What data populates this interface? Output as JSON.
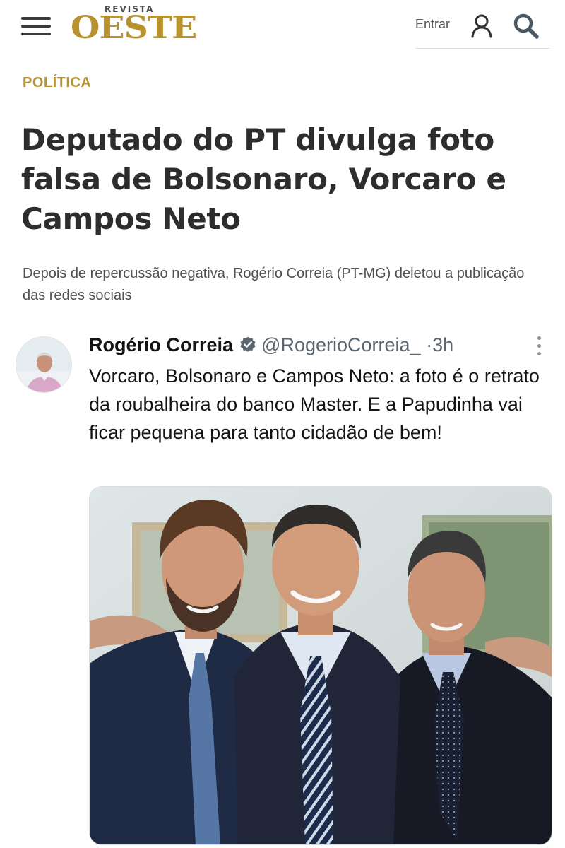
{
  "header": {
    "logo_small": "REVISTA",
    "logo_big": "OESTE",
    "login_label": "Entrar",
    "icons": [
      "menu-icon",
      "user-icon",
      "search-icon"
    ]
  },
  "article": {
    "kicker": "POLÍTICA",
    "headline": "Deputado do PT divulga foto falsa de Bolsonaro, Vorcaro e Campos Neto",
    "subheadline": "Depois de repercussão negativa, Rogério Correia (PT-MG) deletou a publicação das redes sociais"
  },
  "tweet": {
    "author_name": "Rogério Correia",
    "handle": "@RogerioCorreia_",
    "separator": "·",
    "time": "3h",
    "text": "Vorcaro, Bolsonaro e Campos Neto: a foto é o retrato da roubalheira do banco Master. E a Papudinha vai ficar pequena para tanto cidadão de bem!",
    "icons": [
      "verified-icon",
      "more-options-icon"
    ]
  },
  "colors": {
    "brand_gold": "#b8922e",
    "headline": "#2d2d30",
    "verified_blue": "#1d9bf0",
    "muted": "#5b6670"
  }
}
